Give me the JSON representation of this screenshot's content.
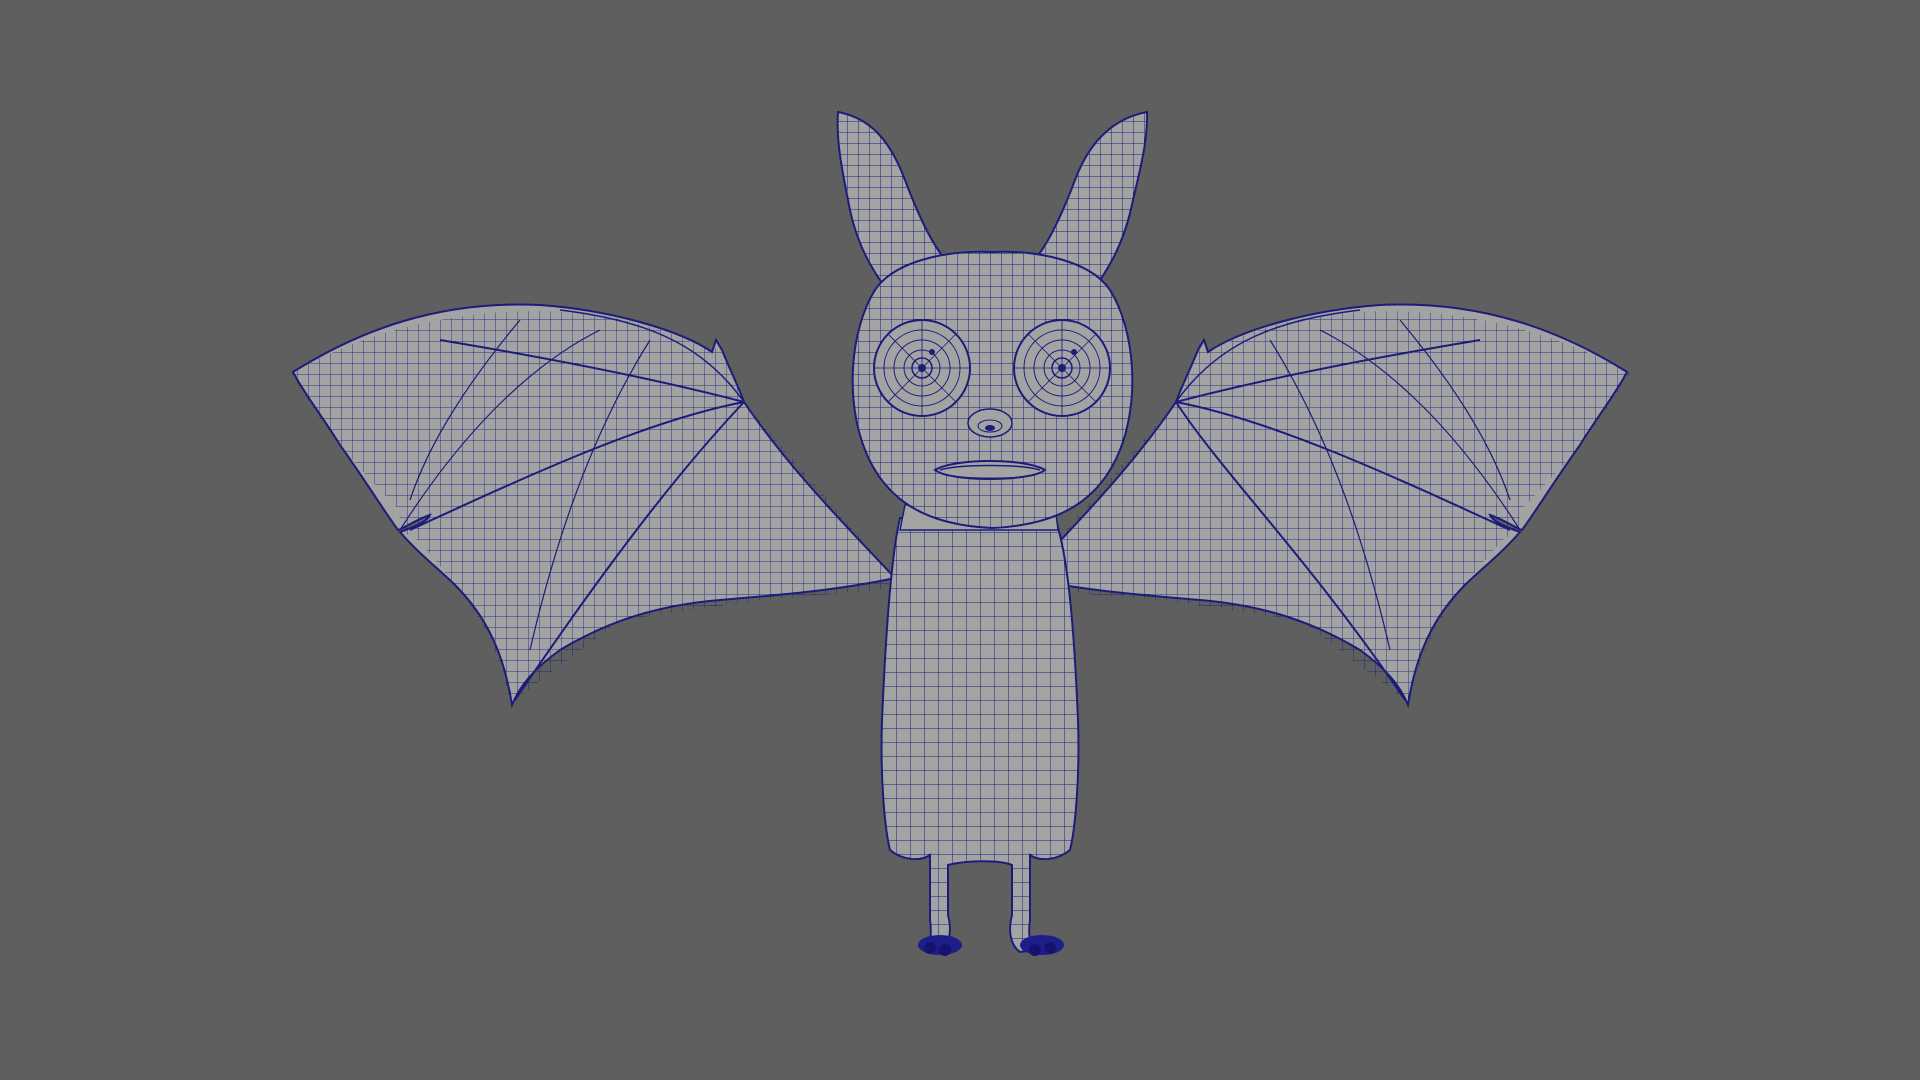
{
  "viewport": {
    "background_color": "#5f5f5f",
    "mesh_fill_color": "#a3a3a3",
    "wire_color": "#1c1c7a",
    "accent_wire_color": "#2020a0",
    "subject": "bat-character-wireframe-mesh"
  }
}
